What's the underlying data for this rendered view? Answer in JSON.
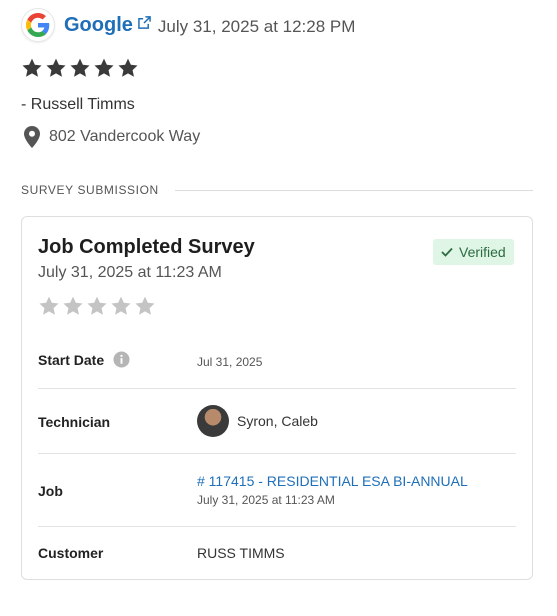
{
  "review": {
    "source": "Google",
    "timestamp": "July 31, 2025 at 12:28 PM",
    "rating": 5,
    "reviewer": "- Russell Timms",
    "address": "802 Vandercook Way"
  },
  "section": {
    "title": "SURVEY SUBMISSION"
  },
  "survey": {
    "title": "Job Completed Survey",
    "date": "July 31, 2025 at 11:23 AM",
    "badge": "Verified",
    "rating": 0,
    "rows": {
      "start_date": {
        "label": "Start Date",
        "value": "Jul 31, 2025"
      },
      "technician": {
        "label": "Technician",
        "value": "Syron, Caleb"
      },
      "job": {
        "label": "Job",
        "link": "# 117415 - RESIDENTIAL ESA BI-ANNUAL",
        "sub": "July 31, 2025 at 11:23 AM"
      },
      "customer": {
        "label": "Customer",
        "value": "RUSS TIMMS"
      }
    }
  },
  "colors": {
    "link": "#1f6fb8",
    "star_filled": "#3a3a3a",
    "star_empty": "#c4c4c4",
    "verified_bg": "#dff5e6",
    "verified_text": "#2d6b40"
  },
  "icons": {
    "google": "google-logo-icon",
    "external": "external-link-icon",
    "pin": "map-pin-icon",
    "info": "info-icon",
    "check": "check-icon",
    "star": "star-icon"
  }
}
